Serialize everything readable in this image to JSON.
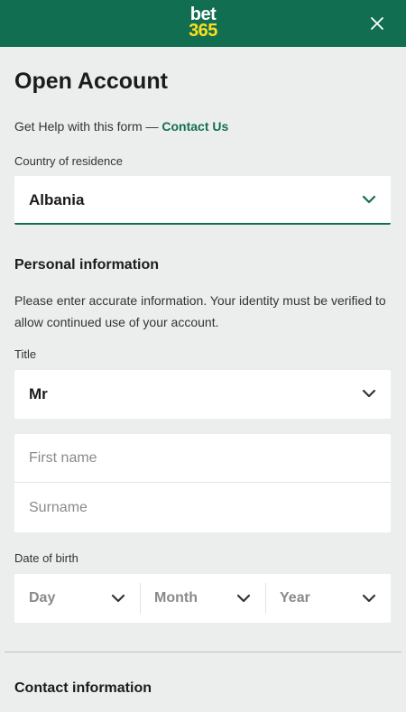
{
  "header": {
    "logo_top": "bet",
    "logo_bottom": "365",
    "brand_color": "#126e51",
    "logo_accent": "#ffdf1b"
  },
  "page": {
    "title": "Open Account"
  },
  "help": {
    "text": "Get Help with this form — ",
    "link": "Contact Us"
  },
  "country": {
    "label": "Country of residence",
    "value": "Albania"
  },
  "personal": {
    "title": "Personal information",
    "description": "Please enter accurate information. Your identity must be verified to allow continued use of your account.",
    "title_field_label": "Title",
    "title_value": "Mr",
    "first_name_placeholder": "First name",
    "surname_placeholder": "Surname",
    "dob_label": "Date of birth",
    "dob_day": "Day",
    "dob_month": "Month",
    "dob_year": "Year"
  },
  "contact": {
    "title": "Contact information"
  },
  "icons": {
    "close": "close-icon",
    "chevron": "chevron-down-icon"
  }
}
